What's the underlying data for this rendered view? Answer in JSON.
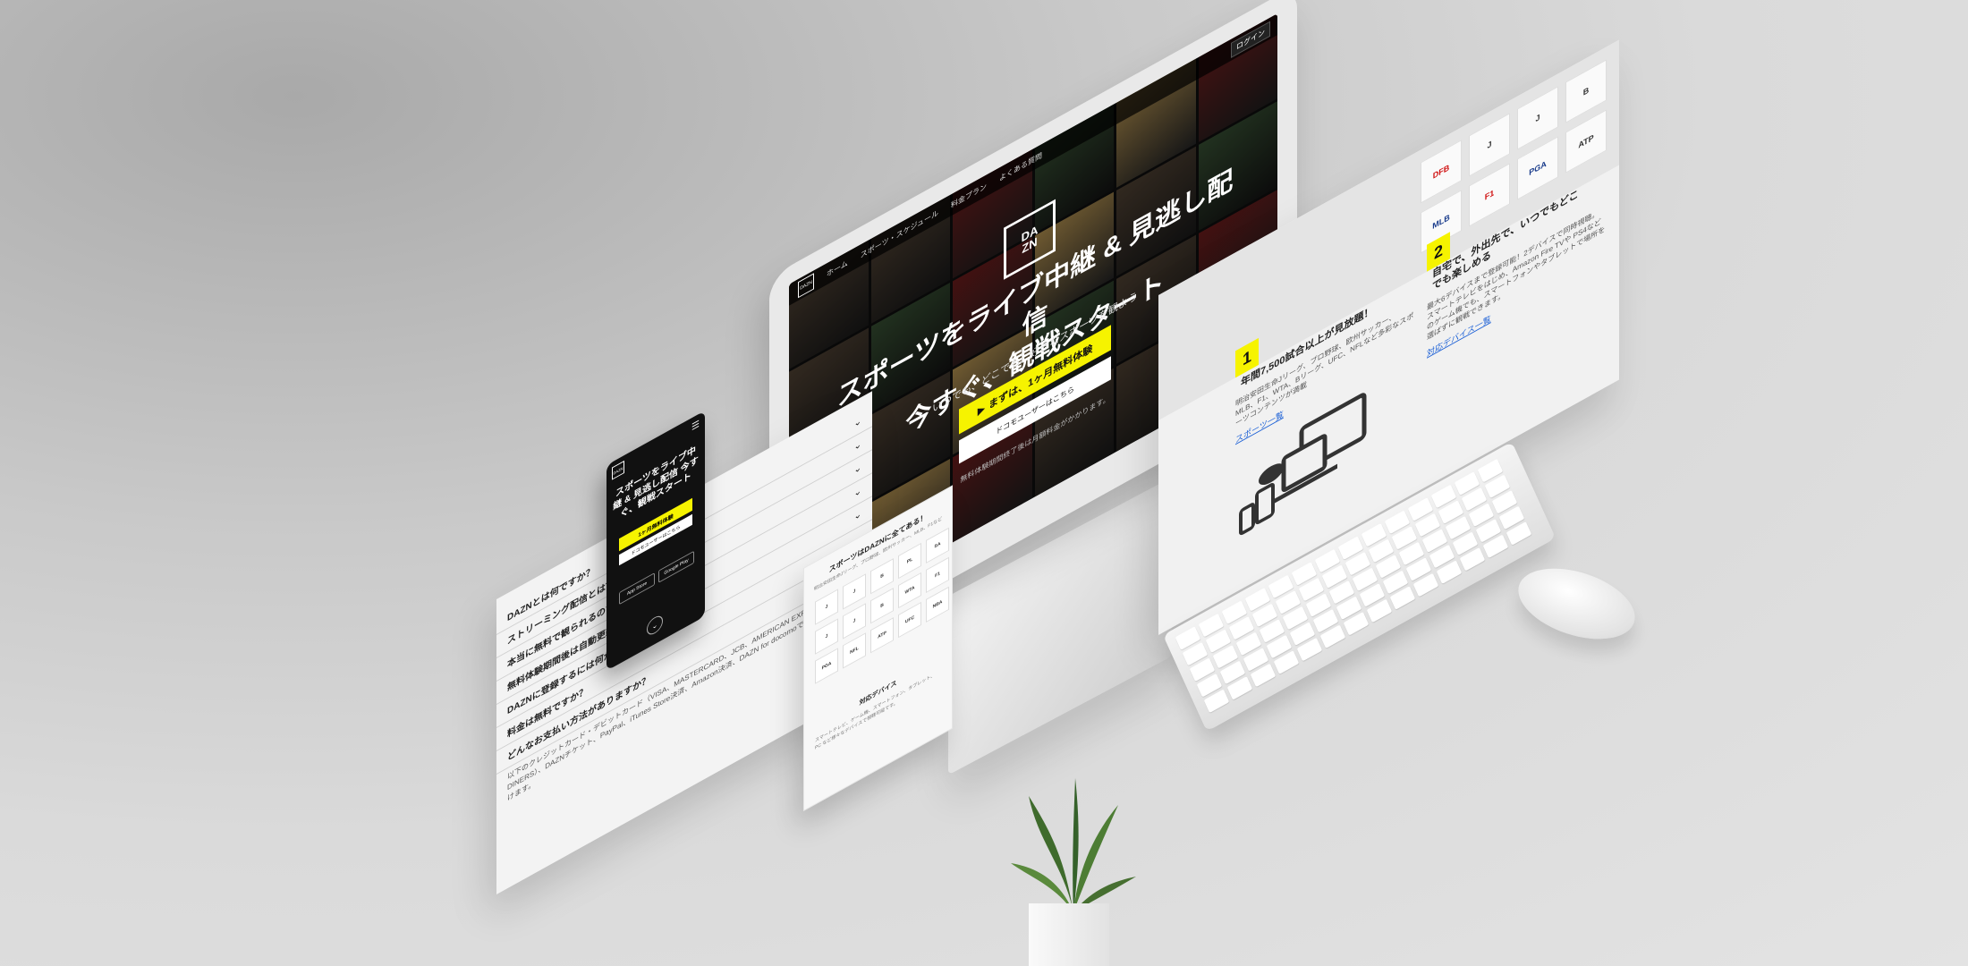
{
  "imac": {
    "nav_logo": "DAZN",
    "nav_items": [
      "ホーム",
      "スポーツ・スケジュール",
      "料金プラン",
      "よくある質問"
    ],
    "login": "ログイン",
    "logo_line1": "DA",
    "logo_line2": "ZN",
    "hero_title_line1": "スポーツをライブ中継 & 見逃し配信",
    "hero_title_line2": "今すぐ、観戦スタート",
    "hero_sub": "いつでも、どこでも、好きなスポーツを観よう",
    "cta_primary": "まずは、1ヶ月無料体験",
    "cta_secondary": "ドコモユーザーはこちら",
    "hero_note": "無料体験期間終了後は月額料金がかかります。"
  },
  "features": {
    "leagues": [
      "DFB",
      "J",
      "J",
      "B",
      "MLB",
      "F1",
      "PGA",
      "ATP"
    ],
    "item1": {
      "num": "1",
      "title": "年間7,500試合以上が見放題！",
      "body": "明治安田生命Jリーグ、プロ野球、欧州サッカー、MLB、F1、WTA、Bリーグ、UFC、NFLなど多彩なスポーツコンテンツが満載",
      "link": "スポーツ一覧"
    },
    "item2": {
      "num": "2",
      "title": "自宅で、外出先で、いつでもどこでも楽しめる",
      "body": "最大6デバイスまで登録可能！2デバイスで同時視聴。スマートテレビをはじめ、Amazon Fire TVや PS4などのゲーム機でも、スマートフォンやタブレットで場所を選ばずに観戦できます。",
      "link": "対応デバイス一覧"
    }
  },
  "faq": {
    "items": [
      "DAZNとは何ですか？",
      "ストリーミング配信とは？",
      "本当に無料で観られるのですか？",
      "無料体験期間後は自動更新？",
      "DAZNに登録するには何が必要ですか？",
      "料金は無料ですか？",
      "どんなお支払い方法がありますか？"
    ],
    "answer": "以下のクレジットカード・デビットカード（VISA、MASTERCARD、JCB、AMERICAN EXPRESS、DINERS）、DAZNチケット、PayPal、iTunes Store決済、Amazon決済、DAZN for docomoでお支払いいただけます。"
  },
  "phone": {
    "logo": "DAZN",
    "menu": "☰",
    "title": "スポーツをライブ中継 & 見逃し配信 今すぐ、観戦スタート",
    "cta": "1ヶ月無料体験",
    "cta2": "ドコモユーザーはこちら",
    "store1": "App Store",
    "store2": "Google Play",
    "home": "⌄"
  },
  "tablet": {
    "title": "スポーツはDAZNに全てある！",
    "sub": "明治安田生命Jリーグ、プロ野球、欧州サッカー、MLB、F1など",
    "logos": [
      "J",
      "J",
      "B",
      "PL",
      "SA",
      "J",
      "J",
      "B",
      "WTA",
      "F1",
      "PGA",
      "NFL",
      "ATP",
      "UFC",
      "NBA"
    ],
    "devices_title": "対応デバイス",
    "devices_body": "スマートテレビ、ゲーム機、スマートフォン、タブレット、PC など様々なデバイスで視聴可能です。"
  },
  "colors": {
    "accent": "#f6f300",
    "dark": "#111111",
    "link": "#1a5fd6"
  }
}
